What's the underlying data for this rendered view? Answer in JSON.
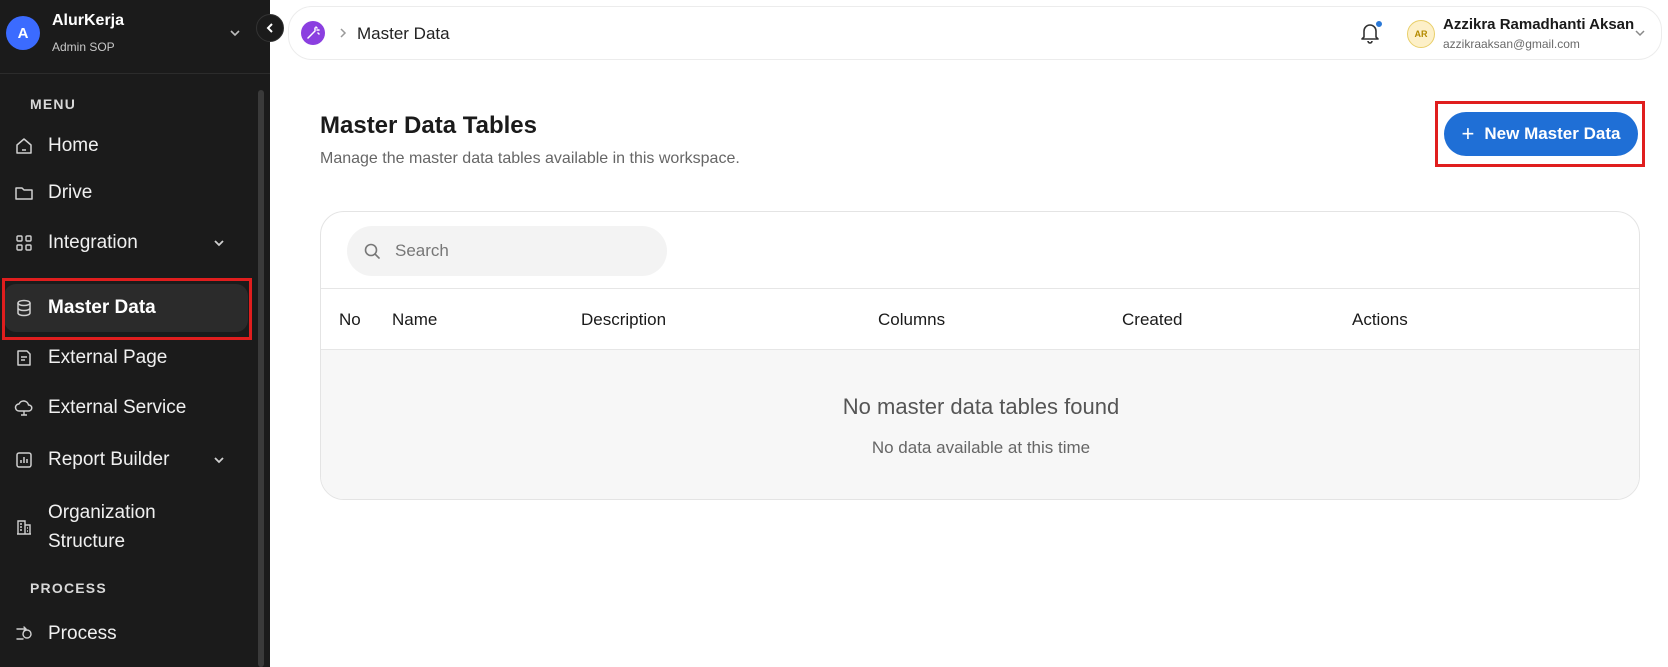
{
  "brand": {
    "initial": "A",
    "name": "AlurKerja",
    "role": "Admin SOP"
  },
  "sidebar": {
    "menu_label": "MENU",
    "process_label": "PROCESS",
    "items": [
      {
        "label": "Home",
        "icon": "home-icon"
      },
      {
        "label": "Drive",
        "icon": "folder-icon"
      },
      {
        "label": "Integration",
        "icon": "grid-icon",
        "expandable": true
      },
      {
        "label": "Master Data",
        "icon": "database-icon",
        "active": true
      },
      {
        "label": "External Page",
        "icon": "page-icon"
      },
      {
        "label": "External Service",
        "icon": "cloud-icon"
      },
      {
        "label": "Report Builder",
        "icon": "chart-icon",
        "expandable": true
      },
      {
        "label": "Organization Structure",
        "icon": "building-icon"
      }
    ],
    "process_items": [
      {
        "label": "Process",
        "icon": "process-icon"
      }
    ]
  },
  "header": {
    "breadcrumb": "Master Data",
    "user": {
      "initials": "AR",
      "name": "Azzikra Ramadhanti Aksan",
      "email": "azzikraaksan@gmail.com"
    }
  },
  "main": {
    "title": "Master Data Tables",
    "subtitle": "Manage the master data tables available in this workspace.",
    "new_button_label": "New Master Data",
    "search_placeholder": "Search",
    "columns": [
      "No",
      "Name",
      "Description",
      "Columns",
      "Created",
      "Actions"
    ],
    "empty_title": "No master data tables found",
    "empty_subtitle": "No data available at this time"
  },
  "colors": {
    "sidebar_bg": "#1b1b1b",
    "primary": "#1f6fd6",
    "highlight": "#e01e1e",
    "brand_avatar": "#3b6bff"
  }
}
